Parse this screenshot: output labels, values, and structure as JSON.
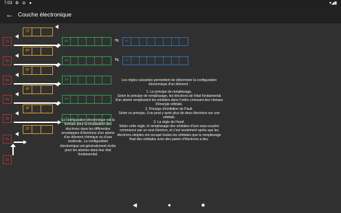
{
  "status_bar": {
    "time": "7:03",
    "icons_left": "⚙ ◘ ●",
    "icons_right": "▾◢▮"
  },
  "app_bar": {
    "back_icon": "arrow-back",
    "title": "Couche électronique"
  },
  "levels": [
    "7s",
    "6s",
    "5s",
    "4s",
    "3s",
    "2s",
    "1s"
  ],
  "orbitals": [
    "7P",
    "6P",
    "5P",
    "4P",
    "3P",
    "2P"
  ],
  "green_rows": [
    {
      "label": "5D"
    },
    {
      "label": "4D"
    },
    {
      "label": "3D"
    },
    {
      "label": "2D"
    },
    {
      "label": "1D"
    }
  ],
  "blue_rows": [
    {
      "label": "5F"
    },
    {
      "label": "4F"
    }
  ],
  "left_text": "La configuration électronique est la formule pour la localisation des électrons dans les différentes enveloppes d'électrons d'un atome d'un élément chimique ou d'une molécule. La configuration électronique est généralement écrite pour les atomes dans leur état fondamental.",
  "right_text": {
    "intro": "Les règles suivantes permettent de déterminer la configuration électronique d'un élément :",
    "rule1_title": "1. Le principe de remplissage.",
    "rule1_body": "Selon le principe de remplissage, les électrons de l'état fondamental d'un atome remplissent les orbitales dans l'ordre croissant des niveaux d'énergie orbitale.",
    "rule2_title": "2. Principe d'inhibition de Pauli.",
    "rule2_body": "Selon ce principe, il ne peut y avoir plus de deux électrons sur une orbitale.",
    "rule3_title": "3. La règle de Hund.",
    "rule3_body": "Selon cette règle, le remplissage des orbitales d'une sous-couche commence par un seul électron, et c'est seulement après que les électrons simples ont occupé toutes les orbitales que le remplissage final des orbitales avec des paires d'électrons a lieu."
  },
  "nav": {
    "back": "◀",
    "home": "●",
    "recents": "■"
  },
  "colors": {
    "s_level": "#b03030",
    "p_orbital": "#d39a28",
    "d_orbital": "#2e9e4e",
    "f_orbital": "#2f6fb0"
  }
}
